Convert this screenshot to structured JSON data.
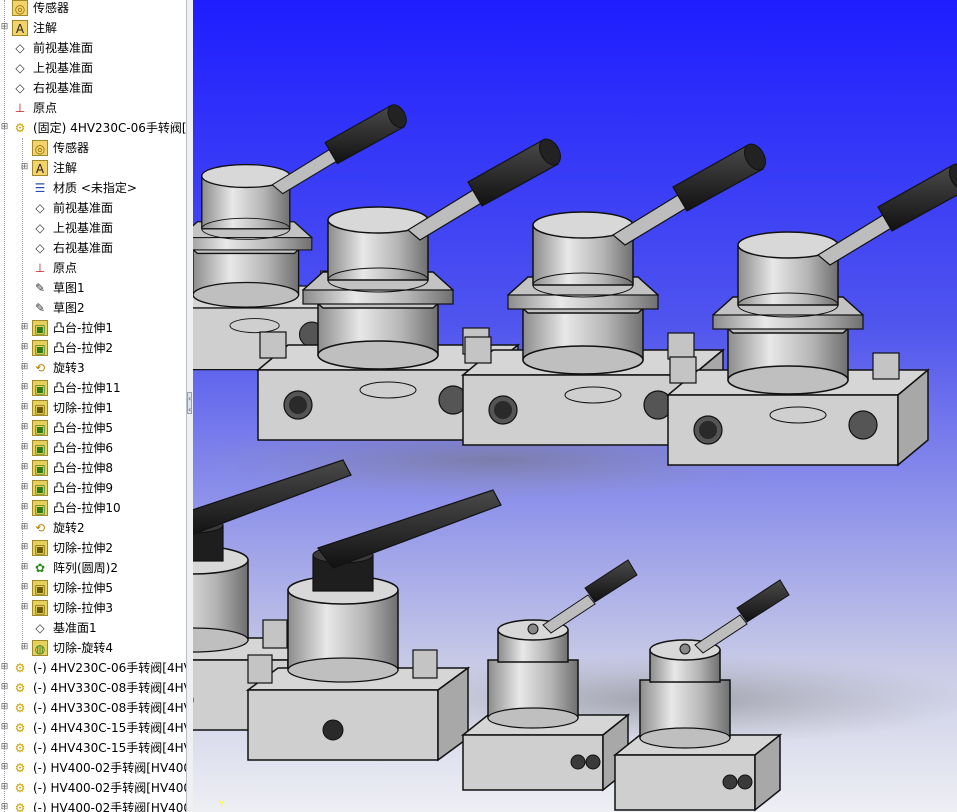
{
  "feature_tree": {
    "items": [
      {
        "label": "传感器",
        "icon": "sensor-icon",
        "depth": 0,
        "expandable": false
      },
      {
        "label": "注解",
        "icon": "annotation-icon",
        "depth": 0,
        "expandable": true
      },
      {
        "label": "前视基准面",
        "icon": "plane-icon",
        "depth": 0,
        "expandable": false
      },
      {
        "label": "上视基准面",
        "icon": "plane-icon",
        "depth": 0,
        "expandable": false
      },
      {
        "label": "右视基准面",
        "icon": "plane-icon",
        "depth": 0,
        "expandable": false
      },
      {
        "label": "原点",
        "icon": "origin-icon",
        "depth": 0,
        "expandable": false
      },
      {
        "label": "(固定) 4HV230C-06手转阀[4",
        "icon": "part-icon",
        "depth": 0,
        "expandable": true
      },
      {
        "label": "传感器",
        "icon": "sensor-icon",
        "depth": 1,
        "expandable": false
      },
      {
        "label": "注解",
        "icon": "annotation-icon",
        "depth": 1,
        "expandable": true
      },
      {
        "label": "材质 <未指定>",
        "icon": "material-icon",
        "depth": 1,
        "expandable": false
      },
      {
        "label": "前视基准面",
        "icon": "plane-icon",
        "depth": 1,
        "expandable": false
      },
      {
        "label": "上视基准面",
        "icon": "plane-icon",
        "depth": 1,
        "expandable": false
      },
      {
        "label": "右视基准面",
        "icon": "plane-icon",
        "depth": 1,
        "expandable": false
      },
      {
        "label": "原点",
        "icon": "origin-icon",
        "depth": 1,
        "expandable": false
      },
      {
        "label": "草图1",
        "icon": "sketch-icon",
        "depth": 1,
        "expandable": false
      },
      {
        "label": "草图2",
        "icon": "sketch-icon",
        "depth": 1,
        "expandable": false
      },
      {
        "label": "凸台-拉伸1",
        "icon": "boss-extrude-icon",
        "depth": 1,
        "expandable": true
      },
      {
        "label": "凸台-拉伸2",
        "icon": "boss-extrude-icon",
        "depth": 1,
        "expandable": true
      },
      {
        "label": "旋转3",
        "icon": "revolve-icon",
        "depth": 1,
        "expandable": true
      },
      {
        "label": "凸台-拉伸11",
        "icon": "boss-extrude-icon",
        "depth": 1,
        "expandable": true
      },
      {
        "label": "切除-拉伸1",
        "icon": "cut-extrude-icon",
        "depth": 1,
        "expandable": true
      },
      {
        "label": "凸台-拉伸5",
        "icon": "boss-extrude-icon",
        "depth": 1,
        "expandable": true
      },
      {
        "label": "凸台-拉伸6",
        "icon": "boss-extrude-icon",
        "depth": 1,
        "expandable": true
      },
      {
        "label": "凸台-拉伸8",
        "icon": "boss-extrude-icon",
        "depth": 1,
        "expandable": true
      },
      {
        "label": "凸台-拉伸9",
        "icon": "boss-extrude-icon",
        "depth": 1,
        "expandable": true
      },
      {
        "label": "凸台-拉伸10",
        "icon": "boss-extrude-icon",
        "depth": 1,
        "expandable": true
      },
      {
        "label": "旋转2",
        "icon": "revolve-icon",
        "depth": 1,
        "expandable": true
      },
      {
        "label": "切除-拉伸2",
        "icon": "cut-extrude-icon",
        "depth": 1,
        "expandable": true
      },
      {
        "label": "阵列(圆周)2",
        "icon": "circular-pattern-icon",
        "depth": 1,
        "expandable": true
      },
      {
        "label": "切除-拉伸5",
        "icon": "cut-extrude-icon",
        "depth": 1,
        "expandable": true
      },
      {
        "label": "切除-拉伸3",
        "icon": "cut-extrude-icon",
        "depth": 1,
        "expandable": true
      },
      {
        "label": "基准面1",
        "icon": "plane-icon",
        "depth": 1,
        "expandable": false
      },
      {
        "label": "切除-旋转4",
        "icon": "cut-revolve-icon",
        "depth": 1,
        "expandable": true
      },
      {
        "label": "(-) 4HV230C-06手转阀[4HV",
        "icon": "part-icon",
        "depth": 0,
        "expandable": true
      },
      {
        "label": "(-) 4HV330C-08手转阀[4HV",
        "icon": "part-icon",
        "depth": 0,
        "expandable": true
      },
      {
        "label": "(-) 4HV330C-08手转阀[4HV",
        "icon": "part-icon",
        "depth": 0,
        "expandable": true
      },
      {
        "label": "(-) 4HV430C-15手转阀[4HV",
        "icon": "part-icon",
        "depth": 0,
        "expandable": true
      },
      {
        "label": "(-) 4HV430C-15手转阀[4HV",
        "icon": "part-icon",
        "depth": 0,
        "expandable": true
      },
      {
        "label": "(-) HV400-02手转阀[HV400",
        "icon": "part-icon",
        "depth": 0,
        "expandable": true
      },
      {
        "label": "(-) HV400-02手转阀[HV400",
        "icon": "part-icon",
        "depth": 0,
        "expandable": true
      },
      {
        "label": "(-) HV400-02手转阀[HV400",
        "icon": "part-icon",
        "depth": 0,
        "expandable": true
      }
    ]
  },
  "viewport": {
    "axis_label": "Y",
    "background_top": "#1d1dff",
    "background_bottom": "#eeeff4",
    "model_colors": {
      "body": "#c9c9c9",
      "handle": "#1e1e1e",
      "edge": "#111111"
    }
  }
}
